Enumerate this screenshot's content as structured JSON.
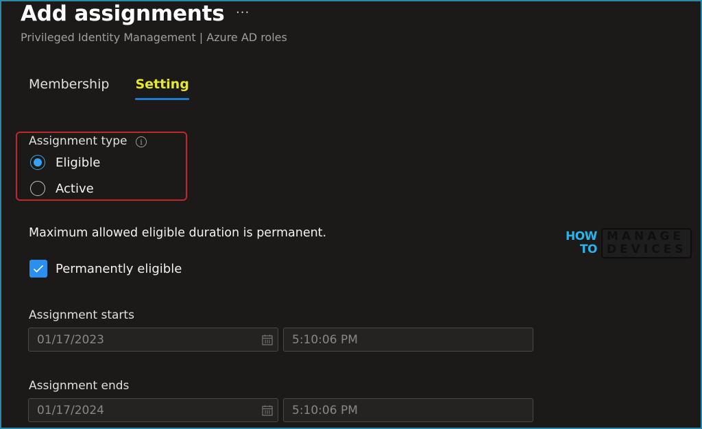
{
  "header": {
    "title": "Add assignments",
    "more_label": "···",
    "subtitle": "Privileged Identity Management | Azure AD roles"
  },
  "tabs": [
    {
      "label": "Membership",
      "active": false
    },
    {
      "label": "Setting",
      "active": true
    }
  ],
  "assignment_type": {
    "label": "Assignment type",
    "info_icon": "info-icon",
    "options": [
      {
        "label": "Eligible",
        "checked": true
      },
      {
        "label": "Active",
        "checked": false
      }
    ]
  },
  "notice": "Maximum allowed eligible duration is permanent.",
  "permanently_eligible": {
    "label": "Permanently eligible",
    "checked": true
  },
  "assignment_starts": {
    "label": "Assignment starts",
    "date": "01/17/2023",
    "time": "5:10:06 PM"
  },
  "assignment_ends": {
    "label": "Assignment ends",
    "date": "01/17/2024",
    "time": "5:10:06 PM"
  },
  "watermark": {
    "line1_left": "HOW",
    "line2_left": "TO",
    "line1_right": "MANAGE",
    "line2_right": "DEVICES"
  },
  "colors": {
    "accent": "#2b8ff0",
    "active_tab": "#e8e82a",
    "highlight_box": "#c4262e",
    "frame": "#2b88a8"
  }
}
